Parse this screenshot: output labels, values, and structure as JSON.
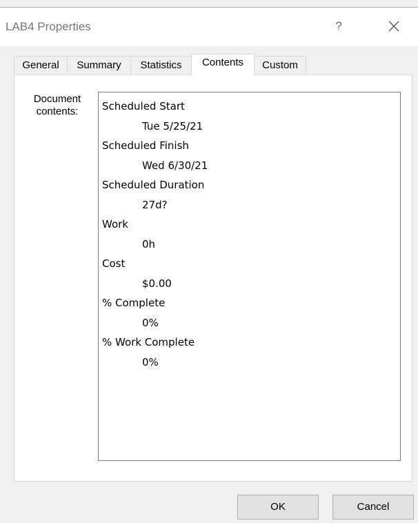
{
  "window": {
    "title": "LAB4 Properties",
    "help_label": "?",
    "close_icon": "close-icon"
  },
  "tabs": [
    {
      "label": "General"
    },
    {
      "label": "Summary"
    },
    {
      "label": "Statistics"
    },
    {
      "label": "Contents",
      "active": true
    },
    {
      "label": "Custom"
    }
  ],
  "contents_tab": {
    "label": "Document contents:",
    "items": [
      {
        "property": "Scheduled Start",
        "value": "Tue 5/25/21"
      },
      {
        "property": "Scheduled Finish",
        "value": "Wed 6/30/21"
      },
      {
        "property": "Scheduled Duration",
        "value": "27d?"
      },
      {
        "property": "Work",
        "value": "0h"
      },
      {
        "property": "Cost",
        "value": "$0.00"
      },
      {
        "property": "% Complete",
        "value": "0%"
      },
      {
        "property": "% Work Complete",
        "value": "0%"
      }
    ]
  },
  "buttons": {
    "ok": "OK",
    "cancel": "Cancel"
  }
}
